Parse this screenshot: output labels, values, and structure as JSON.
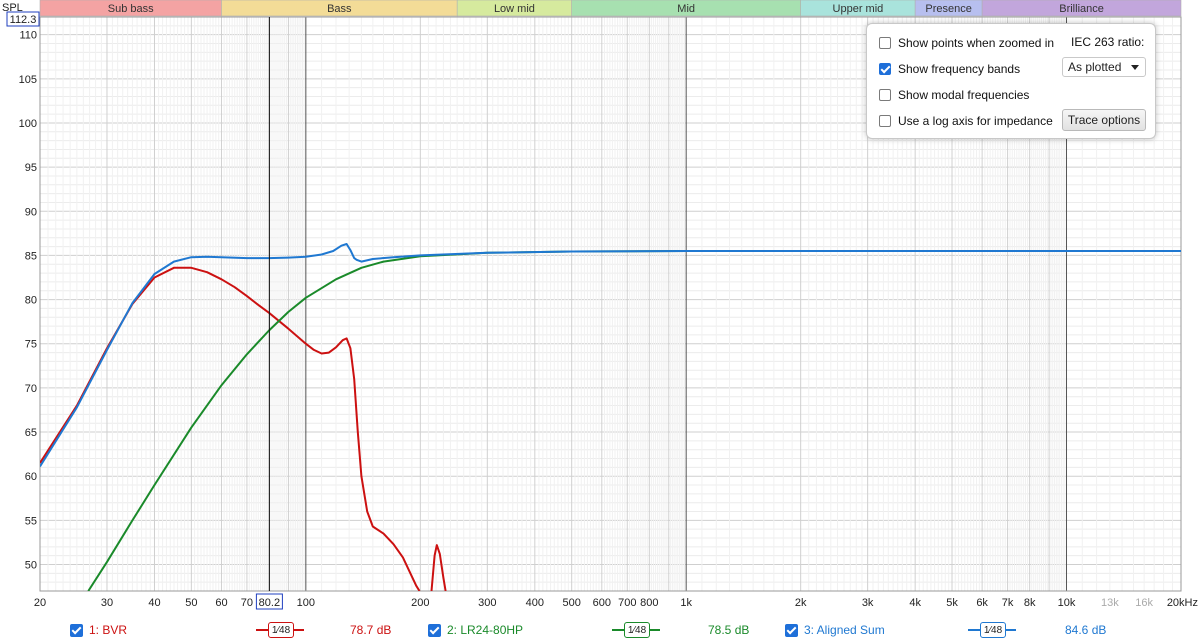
{
  "y_axis_title": "SPL",
  "cursor_spl_value": "112.3",
  "cursor_freq_value": "80.2",
  "colors": {
    "red": "#cc1111",
    "green": "#1a8a2a",
    "blue": "#1f78d1",
    "cursor": "#111111",
    "accent": "#1e6fd9"
  },
  "bands": [
    {
      "label": "Sub bass",
      "from": 20,
      "to": 60,
      "color": "#f4a3a3"
    },
    {
      "label": "Bass",
      "from": 60,
      "to": 250,
      "color": "#f3dc97"
    },
    {
      "label": "Low mid",
      "from": 250,
      "to": 500,
      "color": "#d6ea9e"
    },
    {
      "label": "Mid",
      "from": 500,
      "to": 2000,
      "color": "#a7e0b0"
    },
    {
      "label": "Upper mid",
      "from": 2000,
      "to": 4000,
      "color": "#a9e3dc"
    },
    {
      "label": "Presence",
      "from": 4000,
      "to": 6000,
      "color": "#b7bfef"
    },
    {
      "label": "Brilliance",
      "from": 6000,
      "to": 20000,
      "color": "#c2a6dc"
    }
  ],
  "options_panel": {
    "show_points": {
      "label": "Show points when zoomed in",
      "checked": false
    },
    "show_bands": {
      "label": "Show frequency bands",
      "checked": true
    },
    "show_modal": {
      "label": "Show modal frequencies",
      "checked": false
    },
    "log_impedance": {
      "label": "Use a log axis for impedance",
      "checked": false
    },
    "iec_label": "IEC 263 ratio:",
    "iec_select_value": "As plotted",
    "trace_options_label": "Trace options"
  },
  "legend": [
    {
      "label": "1: BVR",
      "smoothing": "1⁄48",
      "value": "78.7 dB",
      "color": "#cc1111"
    },
    {
      "label": "2: LR24-80HP",
      "smoothing": "1⁄48",
      "value": "78.5 dB",
      "color": "#1a8a2a"
    },
    {
      "label": "3: Aligned Sum",
      "smoothing": "1⁄48",
      "value": "84.6 dB",
      "color": "#1f78d1"
    }
  ],
  "chart_data": {
    "type": "line",
    "x_scale": "log",
    "xlim": [
      20,
      20000
    ],
    "ylim": [
      47,
      112
    ],
    "grid": true,
    "xlabel": "",
    "ylabel": "SPL",
    "x_ticks": [
      {
        "v": 20,
        "t": "20"
      },
      {
        "v": 30,
        "t": "30"
      },
      {
        "v": 40,
        "t": "40"
      },
      {
        "v": 50,
        "t": "50"
      },
      {
        "v": 60,
        "t": "60"
      },
      {
        "v": 70,
        "t": "70"
      },
      {
        "v": 80,
        "t": "80"
      },
      {
        "v": 100,
        "t": "100"
      },
      {
        "v": 200,
        "t": "200"
      },
      {
        "v": 300,
        "t": "300"
      },
      {
        "v": 400,
        "t": "400"
      },
      {
        "v": 500,
        "t": "500"
      },
      {
        "v": 600,
        "t": "600"
      },
      {
        "v": 700,
        "t": "700"
      },
      {
        "v": 800,
        "t": "800"
      },
      {
        "v": 1000,
        "t": "1k"
      },
      {
        "v": 2000,
        "t": "2k"
      },
      {
        "v": 3000,
        "t": "3k"
      },
      {
        "v": 4000,
        "t": "4k"
      },
      {
        "v": 5000,
        "t": "5k"
      },
      {
        "v": 6000,
        "t": "6k"
      },
      {
        "v": 7000,
        "t": "7k"
      },
      {
        "v": 8000,
        "t": "8k"
      },
      {
        "v": 10000,
        "t": "10k"
      },
      {
        "v": 13000,
        "t": "13k",
        "light": true
      },
      {
        "v": 16000,
        "t": "16k",
        "light": true
      },
      {
        "v": 20000,
        "t": "20kHz"
      }
    ],
    "y_ticks": [
      50,
      55,
      60,
      65,
      70,
      75,
      80,
      85,
      90,
      95,
      100,
      105,
      110
    ],
    "cursor_x": 80.2,
    "series": [
      {
        "name": "1: BVR",
        "color": "#cc1111",
        "points": [
          [
            20,
            61.5
          ],
          [
            25,
            68
          ],
          [
            30,
            74.5
          ],
          [
            35,
            79.5
          ],
          [
            40,
            82.5
          ],
          [
            45,
            83.6
          ],
          [
            50,
            83.6
          ],
          [
            55,
            83.1
          ],
          [
            60,
            82.3
          ],
          [
            65,
            81.4
          ],
          [
            70,
            80.4
          ],
          [
            75,
            79.4
          ],
          [
            80,
            78.5
          ],
          [
            90,
            76.7
          ],
          [
            100,
            75
          ],
          [
            105,
            74.3
          ],
          [
            110,
            73.9
          ],
          [
            115,
            74.0
          ],
          [
            120,
            74.6
          ],
          [
            125,
            75.4
          ],
          [
            128,
            75.6
          ],
          [
            131,
            74.5
          ],
          [
            134,
            71
          ],
          [
            137,
            65
          ],
          [
            140,
            60
          ],
          [
            145,
            56
          ],
          [
            150,
            54.3
          ],
          [
            160,
            53.5
          ],
          [
            170,
            52.3
          ],
          [
            180,
            50.8
          ],
          [
            195,
            47.6
          ],
          [
            199,
            47
          ],
          [
            null,
            null
          ],
          [
            214,
            47
          ],
          [
            218,
            51
          ],
          [
            221,
            52.2
          ],
          [
            225,
            51.2
          ],
          [
            230,
            48.5
          ],
          [
            233,
            47
          ]
        ]
      },
      {
        "name": "2: LR24-80HP",
        "color": "#1a8a2a",
        "points": [
          [
            26.8,
            47
          ],
          [
            30,
            50.3
          ],
          [
            35,
            55
          ],
          [
            40,
            59
          ],
          [
            50,
            65.5
          ],
          [
            60,
            70.3
          ],
          [
            70,
            73.8
          ],
          [
            80,
            76.5
          ],
          [
            90,
            78.6
          ],
          [
            100,
            80.2
          ],
          [
            120,
            82.3
          ],
          [
            140,
            83.6
          ],
          [
            160,
            84.3
          ],
          [
            200,
            84.9
          ],
          [
            300,
            85.3
          ],
          [
            500,
            85.45
          ],
          [
            1000,
            85.5
          ],
          [
            20000,
            85.5
          ]
        ]
      },
      {
        "name": "3: Aligned Sum",
        "color": "#1f78d1",
        "points": [
          [
            20,
            61.1
          ],
          [
            25,
            67.8
          ],
          [
            30,
            74.3
          ],
          [
            35,
            79.6
          ],
          [
            40,
            82.9
          ],
          [
            45,
            84.3
          ],
          [
            50,
            84.8
          ],
          [
            55,
            84.85
          ],
          [
            60,
            84.8
          ],
          [
            70,
            84.7
          ],
          [
            80,
            84.7
          ],
          [
            90,
            84.75
          ],
          [
            100,
            84.85
          ],
          [
            110,
            85.1
          ],
          [
            118,
            85.5
          ],
          [
            124,
            86.1
          ],
          [
            128,
            86.3
          ],
          [
            131,
            85.6
          ],
          [
            134,
            84.7
          ],
          [
            136,
            84.5
          ],
          [
            140,
            84.3
          ],
          [
            150,
            84.6
          ],
          [
            170,
            84.8
          ],
          [
            200,
            85.0
          ],
          [
            300,
            85.3
          ],
          [
            500,
            85.45
          ],
          [
            1000,
            85.5
          ],
          [
            20000,
            85.5
          ]
        ]
      }
    ]
  }
}
